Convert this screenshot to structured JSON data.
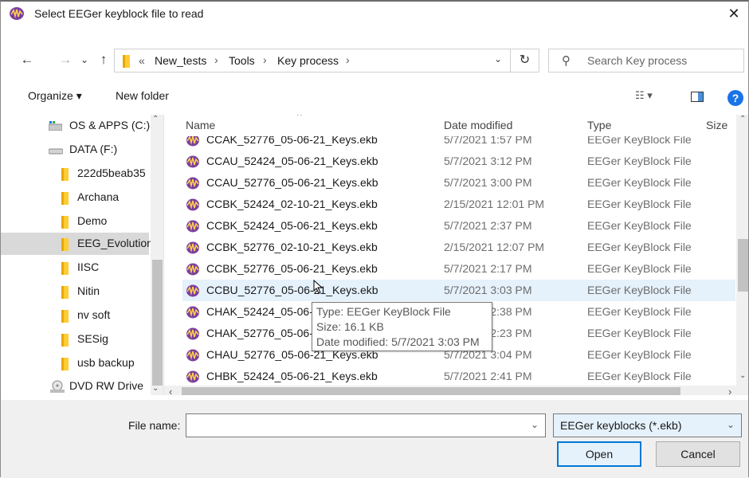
{
  "window": {
    "title": "Select EEGer keyblock file to read",
    "close_glyph": "✕"
  },
  "nav": {
    "back": "←",
    "forward": "→",
    "recent": "⌄",
    "up": "↑",
    "overflow": "«",
    "breadcrumb": [
      "New_tests",
      "Tools",
      "Key process"
    ],
    "sep": "›",
    "refresh": "↻",
    "search_placeholder": "Search Key process"
  },
  "toolbar": {
    "organize": "Organize ▾",
    "new_folder": "New folder",
    "views": "☷ ▾",
    "help": "?"
  },
  "sidebar": {
    "items": [
      {
        "label": "OS & APPS (C:)",
        "icon": "drive-icon"
      },
      {
        "label": "DATA (F:)",
        "icon": "drive-icon"
      },
      {
        "label": "222d5beab35",
        "icon": "folder-icon"
      },
      {
        "label": "Archana",
        "icon": "folder-icon"
      },
      {
        "label": "Demo",
        "icon": "folder-icon"
      },
      {
        "label": "EEG_Evolution",
        "icon": "folder-icon"
      },
      {
        "label": "IISC",
        "icon": "folder-icon"
      },
      {
        "label": "Nitin",
        "icon": "folder-icon"
      },
      {
        "label": "nv soft",
        "icon": "folder-icon"
      },
      {
        "label": "SESig",
        "icon": "folder-icon"
      },
      {
        "label": "usb backup",
        "icon": "folder-icon"
      },
      {
        "label": "DVD RW Drive",
        "icon": "dvd-icon"
      }
    ],
    "selected_index": 5
  },
  "columns": {
    "name": "Name",
    "date": "Date modified",
    "type": "Type",
    "size": "Size"
  },
  "files": [
    {
      "name": "CCAK_52776_05-06-21_Keys.ekb",
      "date": "5/7/2021 1:57 PM",
      "type": "EEGer KeyBlock File"
    },
    {
      "name": "CCAU_52424_05-06-21_Keys.ekb",
      "date": "5/7/2021 3:12 PM",
      "type": "EEGer KeyBlock File"
    },
    {
      "name": "CCAU_52776_05-06-21_Keys.ekb",
      "date": "5/7/2021 3:00 PM",
      "type": "EEGer KeyBlock File"
    },
    {
      "name": "CCBK_52424_02-10-21_Keys.ekb",
      "date": "2/15/2021 12:01 PM",
      "type": "EEGer KeyBlock File"
    },
    {
      "name": "CCBK_52424_05-06-21_Keys.ekb",
      "date": "5/7/2021 2:37 PM",
      "type": "EEGer KeyBlock File"
    },
    {
      "name": "CCBK_52776_02-10-21_Keys.ekb",
      "date": "2/15/2021 12:07 PM",
      "type": "EEGer KeyBlock File"
    },
    {
      "name": "CCBK_52776_05-06-21_Keys.ekb",
      "date": "5/7/2021 2:17 PM",
      "type": "EEGer KeyBlock File"
    },
    {
      "name": "CCBU_52776_05-06-21_Keys.ekb",
      "date": "5/7/2021 3:03 PM",
      "type": "EEGer KeyBlock File"
    },
    {
      "name": "CHAK_52424_05-06-21_Keys.ekb",
      "date": "5/7/2021 2:38 PM",
      "type": "EEGer KeyBlock File"
    },
    {
      "name": "CHAK_52776_05-06-21_Keys.ekb",
      "date": "5/7/2021 2:23 PM",
      "type": "EEGer KeyBlock File"
    },
    {
      "name": "CHAU_52776_05-06-21_Keys.ekb",
      "date": "5/7/2021 3:04 PM",
      "type": "EEGer KeyBlock File"
    },
    {
      "name": "CHBK_52424_05-06-21_Keys.ekb",
      "date": "5/7/2021 2:41 PM",
      "type": "EEGer KeyBlock File"
    }
  ],
  "hovered_index": 7,
  "tooltip": {
    "type": "Type: EEGer KeyBlock File",
    "size": "Size: 16.1 KB",
    "modified": "Date modified: 5/7/2021 3:03 PM"
  },
  "footer": {
    "file_name_label": "File name:",
    "file_name_value": "",
    "filter": "EEGer keyblocks (*.ekb)",
    "open": "Open",
    "cancel": "Cancel"
  },
  "colors": {
    "accent": "#0078d7",
    "hover": "#e5f1fb",
    "selected": "#d9d9d9",
    "folder": "#ffcc33"
  }
}
